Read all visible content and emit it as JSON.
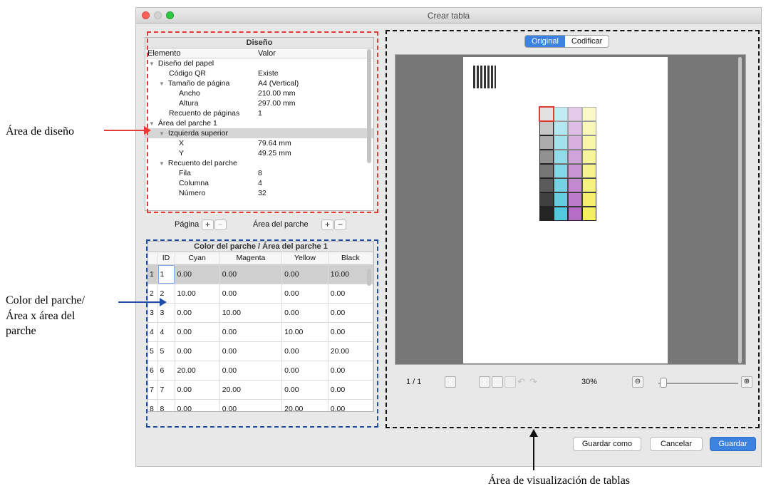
{
  "window": {
    "title": "Crear tabla"
  },
  "callouts": {
    "design": "Área de diseño",
    "patch_color": [
      "Color del parche/",
      "Área x área del",
      "parche"
    ],
    "table_view": "Área de visualización de tablas"
  },
  "design_panel": {
    "header": "Diseño",
    "col_element": "Elemento",
    "col_value": "Valor",
    "rows": [
      {
        "label": "Diseño del papel",
        "value": "",
        "level": 0,
        "expanded": true
      },
      {
        "label": "Código QR",
        "value": "Existe",
        "level": 1
      },
      {
        "label": "Tamaño de página",
        "value": "A4 (Vertical)",
        "level": 1,
        "expanded": true
      },
      {
        "label": "Ancho",
        "value": "210.00 mm",
        "level": 2
      },
      {
        "label": "Altura",
        "value": "297.00 mm",
        "level": 2
      },
      {
        "label": "Recuento de páginas",
        "value": "1",
        "level": 1
      },
      {
        "label": "Área del parche 1",
        "value": "",
        "level": 0,
        "expanded": true
      },
      {
        "label": "Izquierda superior",
        "value": "",
        "level": 1,
        "expanded": true,
        "selected": true
      },
      {
        "label": "X",
        "value": "79.64 mm",
        "level": 2
      },
      {
        "label": "Y",
        "value": "49.25 mm",
        "level": 2
      },
      {
        "label": "Recuento del parche",
        "value": "",
        "level": 1,
        "expanded": true
      },
      {
        "label": "Fila",
        "value": "8",
        "level": 2
      },
      {
        "label": "Columna",
        "value": "4",
        "level": 2
      },
      {
        "label": "Número",
        "value": "32",
        "level": 2
      }
    ]
  },
  "controls": {
    "page_label": "Página",
    "patch_area_label": "Área del parche",
    "plus": "+",
    "minus": "−"
  },
  "patch_table": {
    "header": "Color del parche / Área del parche 1",
    "columns": [
      "ID",
      "Cyan",
      "Magenta",
      "Yellow",
      "Black"
    ],
    "rows": [
      [
        "1",
        "1",
        "0.00",
        "0.00",
        "0.00",
        "10.00"
      ],
      [
        "2",
        "2",
        "10.00",
        "0.00",
        "0.00",
        "0.00"
      ],
      [
        "3",
        "3",
        "0.00",
        "10.00",
        "0.00",
        "0.00"
      ],
      [
        "4",
        "4",
        "0.00",
        "0.00",
        "10.00",
        "0.00"
      ],
      [
        "5",
        "5",
        "0.00",
        "0.00",
        "0.00",
        "20.00"
      ],
      [
        "6",
        "6",
        "20.00",
        "0.00",
        "0.00",
        "0.00"
      ],
      [
        "7",
        "7",
        "0.00",
        "20.00",
        "0.00",
        "0.00"
      ],
      [
        "8",
        "8",
        "0.00",
        "0.00",
        "20.00",
        "0.00"
      ]
    ]
  },
  "preview": {
    "tab_original": "Original",
    "tab_encode": "Codificar",
    "page_counter": "1 / 1",
    "zoom": "30%",
    "zoom_level_fraction": 0.05
  },
  "buttons": {
    "save_as": "Guardar como",
    "cancel": "Cancelar",
    "save": "Guardar"
  },
  "colors": {
    "red_dash": "#e53935",
    "blue_dash": "#1e4fa8",
    "black_dash": "#111111",
    "accent": "#3c82e0",
    "cyan": "#4fc9dd",
    "magenta": "#b46bc5",
    "yellow": "#f3ef5d"
  }
}
